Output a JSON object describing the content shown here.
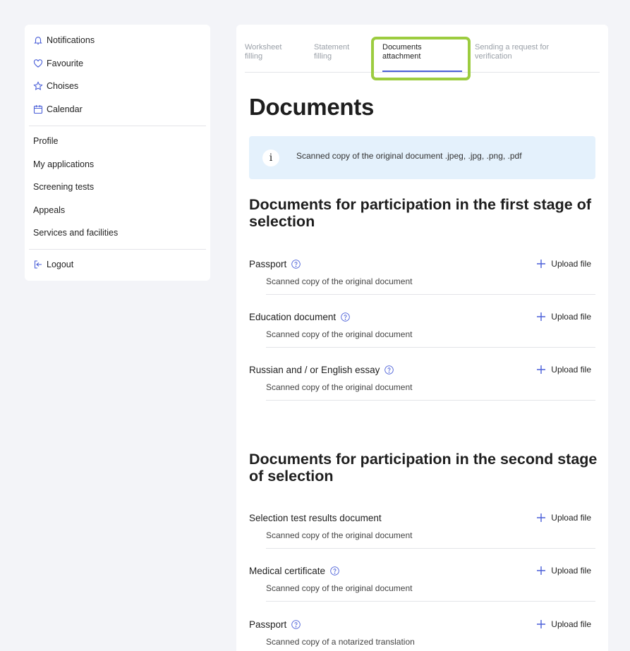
{
  "sidebar": {
    "group1": [
      {
        "label": "Notifications",
        "icon": "bell-icon"
      },
      {
        "label": "Favourite",
        "icon": "heart-icon"
      },
      {
        "label": "Choises",
        "icon": "star-icon"
      },
      {
        "label": "Calendar",
        "icon": "calendar-icon"
      }
    ],
    "group2": [
      {
        "label": "Profile"
      },
      {
        "label": "My applications"
      },
      {
        "label": "Screening tests"
      },
      {
        "label": "Appeals"
      },
      {
        "label": "Services and facilities"
      }
    ],
    "logout": {
      "label": "Logout",
      "icon": "logout-icon"
    }
  },
  "tabs": [
    {
      "label": "Worksheet\nfilling",
      "active": false
    },
    {
      "label": "Statement\nfilling",
      "active": false
    },
    {
      "label": "Documents\nattachment",
      "active": true
    },
    {
      "label": "Sending a request for\nverification",
      "active": false
    }
  ],
  "page": {
    "title": "Documents",
    "info": "Scanned copy of the original document .jpeg, .jpg, .png, .pdf",
    "upload_label": "Upload file"
  },
  "sections": [
    {
      "title": "Documents for participation in the first stage of selection",
      "docs": [
        {
          "name": "Passport",
          "desc": "Scanned copy of the original document",
          "help": true
        },
        {
          "name": "Education document",
          "desc": "Scanned copy of the original document",
          "help": true
        },
        {
          "name": "Russian and / or English essay",
          "desc": "Scanned copy of the original document",
          "help": true
        }
      ]
    },
    {
      "title": "Documents for participation in the second stage of selection",
      "docs": [
        {
          "name": "Selection test results document",
          "desc": "Scanned copy of the original document",
          "help": false
        },
        {
          "name": "Medical certificate",
          "desc": "Scanned copy of the original document",
          "help": true
        },
        {
          "name": "Passport",
          "desc": "Scanned copy of a notarized translation",
          "help": true
        }
      ]
    }
  ],
  "colors": {
    "accent": "#4a5fd8",
    "highlight": "#9ccc3f",
    "info_bg": "#e4f1fc",
    "page_bg": "#f3f4f8"
  }
}
